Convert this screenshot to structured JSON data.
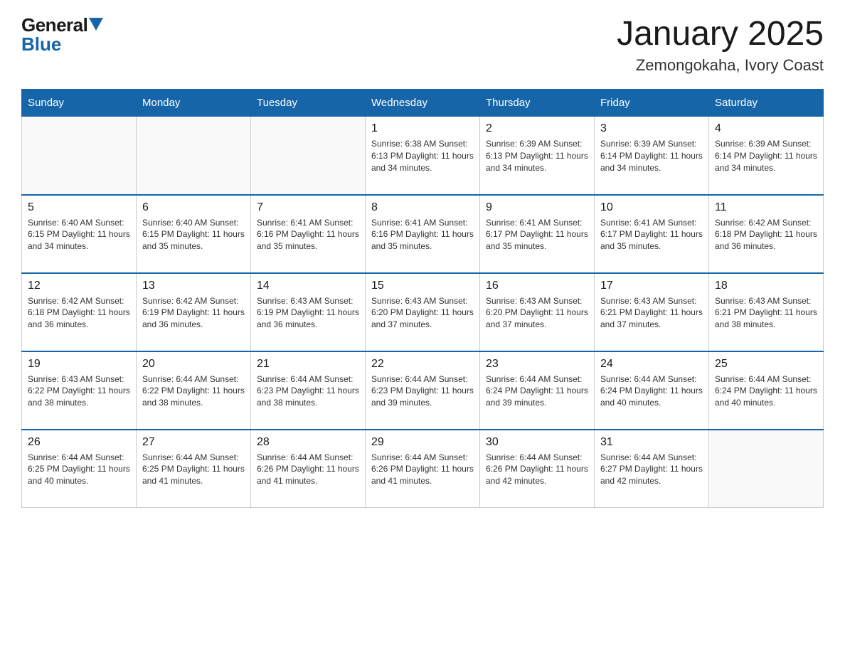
{
  "logo": {
    "general": "General",
    "triangle": "▶",
    "blue": "Blue"
  },
  "title": "January 2025",
  "subtitle": "Zemongokaha, Ivory Coast",
  "days_of_week": [
    "Sunday",
    "Monday",
    "Tuesday",
    "Wednesday",
    "Thursday",
    "Friday",
    "Saturday"
  ],
  "weeks": [
    [
      {
        "day": "",
        "info": ""
      },
      {
        "day": "",
        "info": ""
      },
      {
        "day": "",
        "info": ""
      },
      {
        "day": "1",
        "info": "Sunrise: 6:38 AM\nSunset: 6:13 PM\nDaylight: 11 hours and 34 minutes."
      },
      {
        "day": "2",
        "info": "Sunrise: 6:39 AM\nSunset: 6:13 PM\nDaylight: 11 hours and 34 minutes."
      },
      {
        "day": "3",
        "info": "Sunrise: 6:39 AM\nSunset: 6:14 PM\nDaylight: 11 hours and 34 minutes."
      },
      {
        "day": "4",
        "info": "Sunrise: 6:39 AM\nSunset: 6:14 PM\nDaylight: 11 hours and 34 minutes."
      }
    ],
    [
      {
        "day": "5",
        "info": "Sunrise: 6:40 AM\nSunset: 6:15 PM\nDaylight: 11 hours and 34 minutes."
      },
      {
        "day": "6",
        "info": "Sunrise: 6:40 AM\nSunset: 6:15 PM\nDaylight: 11 hours and 35 minutes."
      },
      {
        "day": "7",
        "info": "Sunrise: 6:41 AM\nSunset: 6:16 PM\nDaylight: 11 hours and 35 minutes."
      },
      {
        "day": "8",
        "info": "Sunrise: 6:41 AM\nSunset: 6:16 PM\nDaylight: 11 hours and 35 minutes."
      },
      {
        "day": "9",
        "info": "Sunrise: 6:41 AM\nSunset: 6:17 PM\nDaylight: 11 hours and 35 minutes."
      },
      {
        "day": "10",
        "info": "Sunrise: 6:41 AM\nSunset: 6:17 PM\nDaylight: 11 hours and 35 minutes."
      },
      {
        "day": "11",
        "info": "Sunrise: 6:42 AM\nSunset: 6:18 PM\nDaylight: 11 hours and 36 minutes."
      }
    ],
    [
      {
        "day": "12",
        "info": "Sunrise: 6:42 AM\nSunset: 6:18 PM\nDaylight: 11 hours and 36 minutes."
      },
      {
        "day": "13",
        "info": "Sunrise: 6:42 AM\nSunset: 6:19 PM\nDaylight: 11 hours and 36 minutes."
      },
      {
        "day": "14",
        "info": "Sunrise: 6:43 AM\nSunset: 6:19 PM\nDaylight: 11 hours and 36 minutes."
      },
      {
        "day": "15",
        "info": "Sunrise: 6:43 AM\nSunset: 6:20 PM\nDaylight: 11 hours and 37 minutes."
      },
      {
        "day": "16",
        "info": "Sunrise: 6:43 AM\nSunset: 6:20 PM\nDaylight: 11 hours and 37 minutes."
      },
      {
        "day": "17",
        "info": "Sunrise: 6:43 AM\nSunset: 6:21 PM\nDaylight: 11 hours and 37 minutes."
      },
      {
        "day": "18",
        "info": "Sunrise: 6:43 AM\nSunset: 6:21 PM\nDaylight: 11 hours and 38 minutes."
      }
    ],
    [
      {
        "day": "19",
        "info": "Sunrise: 6:43 AM\nSunset: 6:22 PM\nDaylight: 11 hours and 38 minutes."
      },
      {
        "day": "20",
        "info": "Sunrise: 6:44 AM\nSunset: 6:22 PM\nDaylight: 11 hours and 38 minutes."
      },
      {
        "day": "21",
        "info": "Sunrise: 6:44 AM\nSunset: 6:23 PM\nDaylight: 11 hours and 38 minutes."
      },
      {
        "day": "22",
        "info": "Sunrise: 6:44 AM\nSunset: 6:23 PM\nDaylight: 11 hours and 39 minutes."
      },
      {
        "day": "23",
        "info": "Sunrise: 6:44 AM\nSunset: 6:24 PM\nDaylight: 11 hours and 39 minutes."
      },
      {
        "day": "24",
        "info": "Sunrise: 6:44 AM\nSunset: 6:24 PM\nDaylight: 11 hours and 40 minutes."
      },
      {
        "day": "25",
        "info": "Sunrise: 6:44 AM\nSunset: 6:24 PM\nDaylight: 11 hours and 40 minutes."
      }
    ],
    [
      {
        "day": "26",
        "info": "Sunrise: 6:44 AM\nSunset: 6:25 PM\nDaylight: 11 hours and 40 minutes."
      },
      {
        "day": "27",
        "info": "Sunrise: 6:44 AM\nSunset: 6:25 PM\nDaylight: 11 hours and 41 minutes."
      },
      {
        "day": "28",
        "info": "Sunrise: 6:44 AM\nSunset: 6:26 PM\nDaylight: 11 hours and 41 minutes."
      },
      {
        "day": "29",
        "info": "Sunrise: 6:44 AM\nSunset: 6:26 PM\nDaylight: 11 hours and 41 minutes."
      },
      {
        "day": "30",
        "info": "Sunrise: 6:44 AM\nSunset: 6:26 PM\nDaylight: 11 hours and 42 minutes."
      },
      {
        "day": "31",
        "info": "Sunrise: 6:44 AM\nSunset: 6:27 PM\nDaylight: 11 hours and 42 minutes."
      },
      {
        "day": "",
        "info": ""
      }
    ]
  ]
}
